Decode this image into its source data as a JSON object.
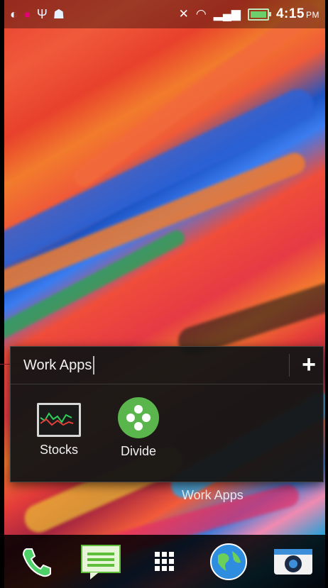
{
  "status_bar": {
    "time": "4:15",
    "time_suffix": "PM"
  },
  "folder": {
    "name": "Work Apps",
    "add_label": "+",
    "apps": [
      {
        "label": "Stocks",
        "icon": "stocks-icon"
      },
      {
        "label": "Divide",
        "icon": "divide-icon"
      }
    ]
  },
  "home": {
    "folder_label": "Work Apps"
  },
  "dock": {
    "items": [
      "phone-icon",
      "messages-icon",
      "app-drawer-icon",
      "browser-icon",
      "camera-icon"
    ]
  },
  "colors": {
    "divide_green": "#5ab64c",
    "leader_line": "#9b1b2c"
  }
}
